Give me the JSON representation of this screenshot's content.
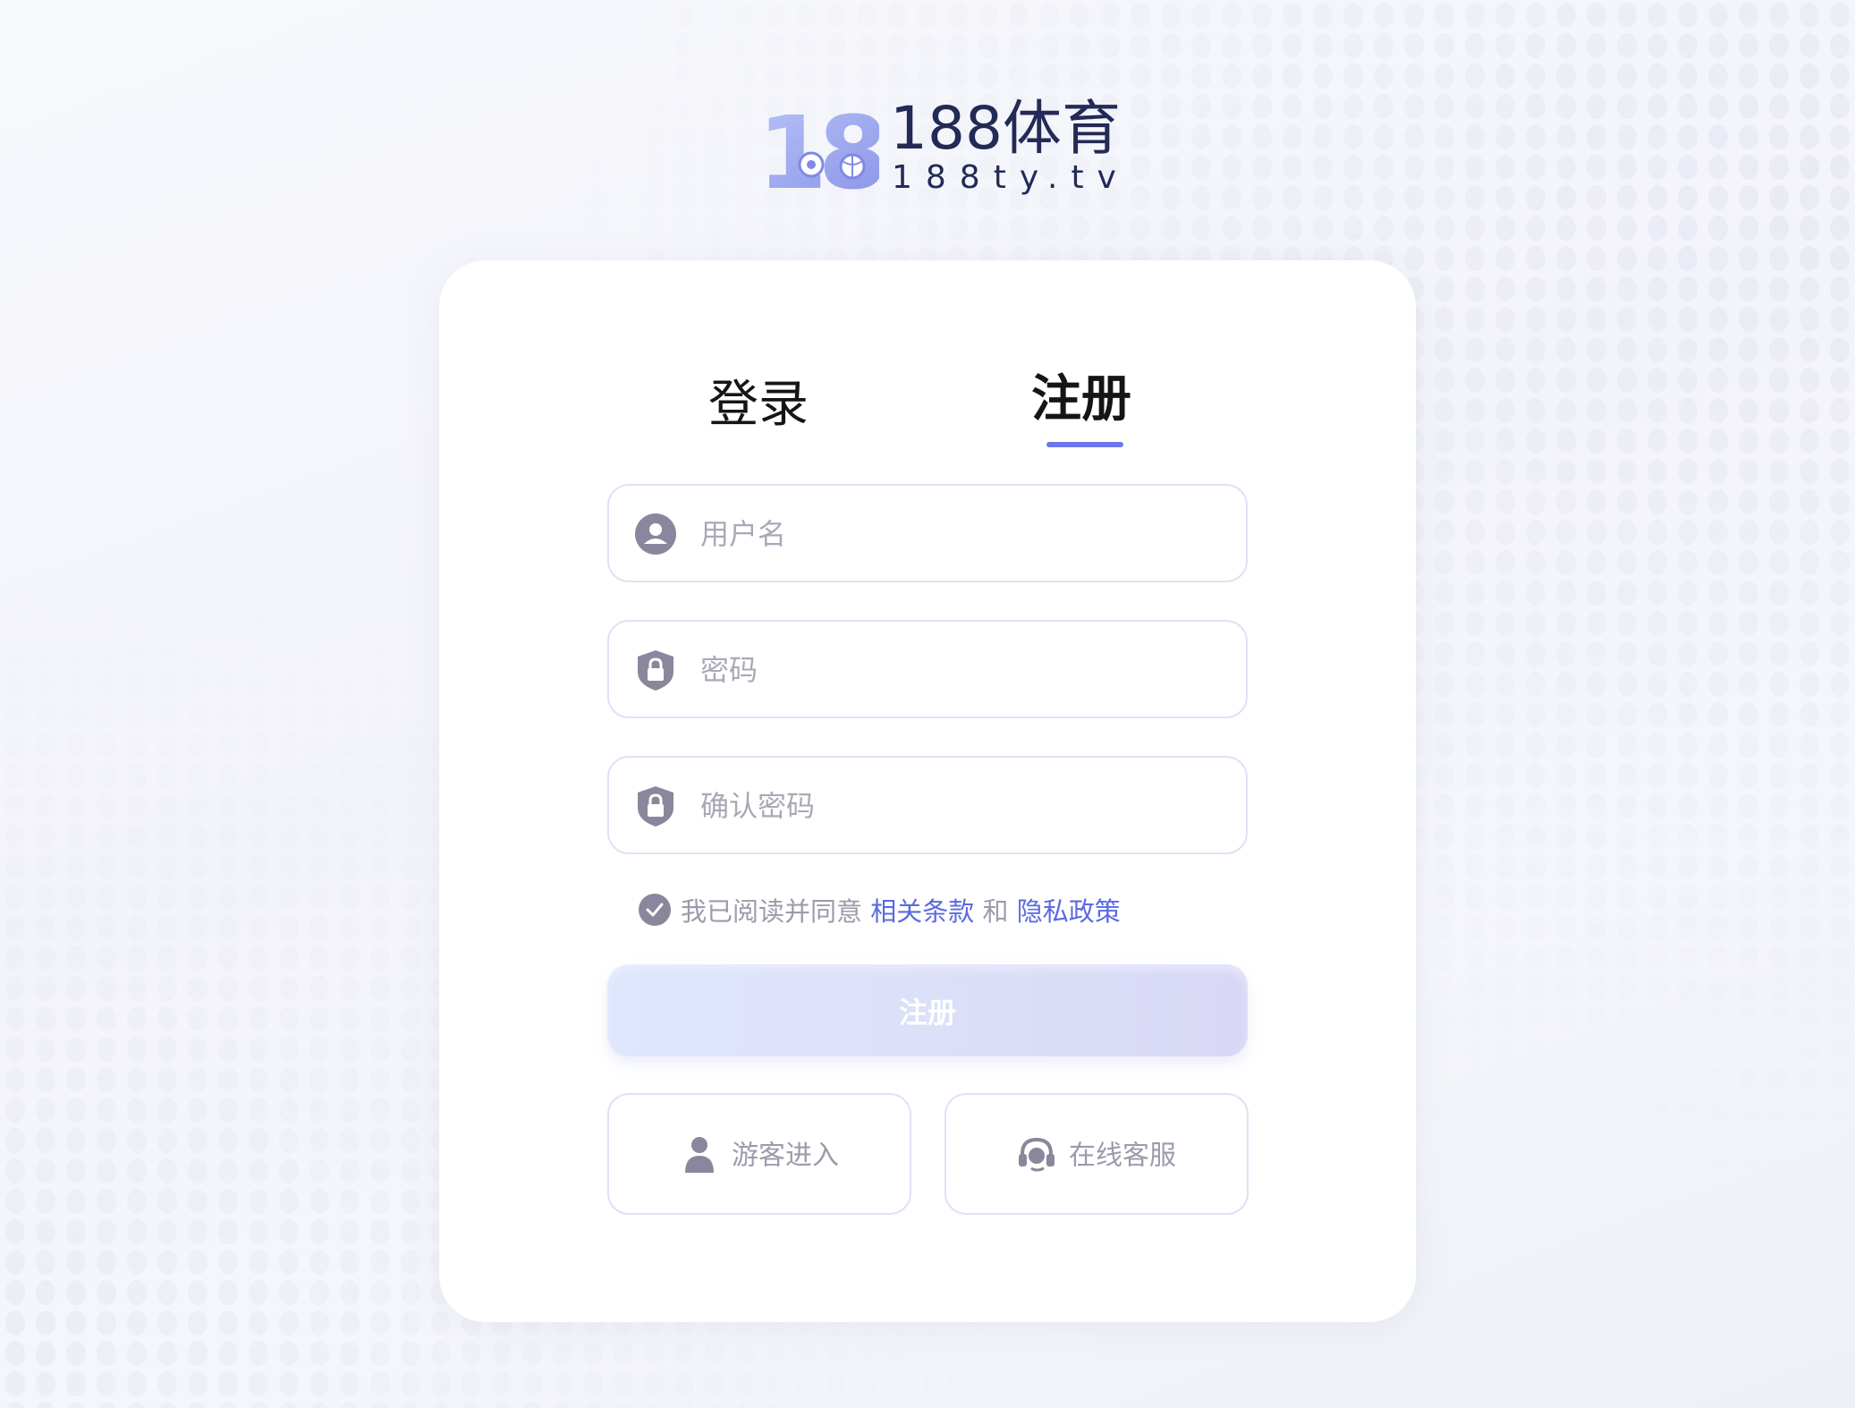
{
  "brand": {
    "mark_text": "188",
    "name": "188体育",
    "domain": "188ty.tv"
  },
  "tabs": [
    {
      "label": "登录",
      "active": false
    },
    {
      "label": "注册",
      "active": true
    }
  ],
  "form": {
    "username": {
      "placeholder": "用户名",
      "value": "",
      "icon": "user-icon"
    },
    "password": {
      "placeholder": "密码",
      "value": "",
      "icon": "lock-shield-icon"
    },
    "confirm_password": {
      "placeholder": "确认密码",
      "value": "",
      "icon": "lock-shield-icon"
    },
    "agreement": {
      "checked": true,
      "prefix": "我已阅读并同意",
      "terms_link": "相关条款",
      "joiner": "和",
      "privacy_link": "隐私政策"
    },
    "submit_label": "注册"
  },
  "actions": {
    "guest": {
      "label": "游客进入",
      "icon": "guest-user-icon"
    },
    "support": {
      "label": "在线客服",
      "icon": "headset-icon"
    }
  },
  "colors": {
    "accent": "#6b78e8",
    "link": "#5b6ae0",
    "field_border": "#dfe2f4",
    "muted_text": "#9a9cac",
    "brand_text": "#222a55",
    "icon_gray": "#8a879c"
  }
}
